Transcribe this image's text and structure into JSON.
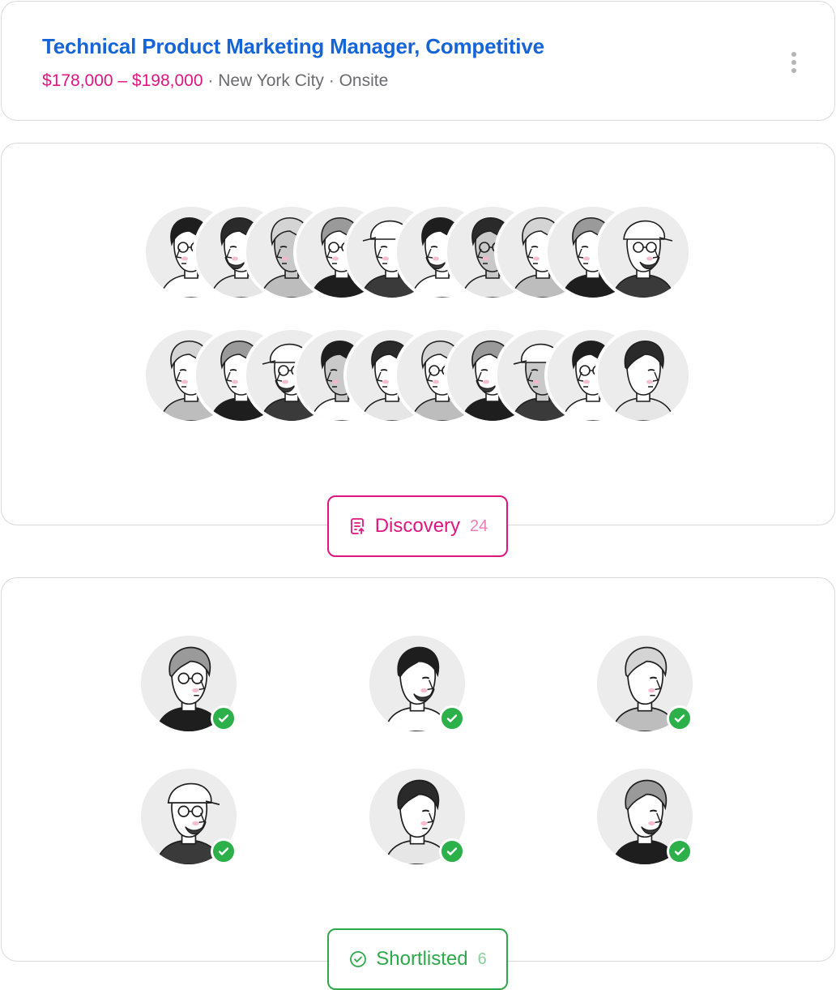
{
  "job": {
    "title": "Technical Product Marketing Manager, Competitive",
    "salary": "$178,000 – $198,000",
    "location_details": " · New York City · Onsite"
  },
  "header": {
    "menu_icon": "more-vertical-icon"
  },
  "discovery": {
    "label": "Discovery",
    "count": "24",
    "icon": "document-upload-icon",
    "accent": "#e0157f"
  },
  "shortlisted": {
    "label": "Shortlisted",
    "count": "6",
    "icon": "check-circle-icon",
    "accent": "#2ea84a"
  },
  "colors": {
    "title": "#1565d8",
    "salary": "#e0157f",
    "meta": "#6b6b70",
    "border": "#d9d9dc"
  }
}
